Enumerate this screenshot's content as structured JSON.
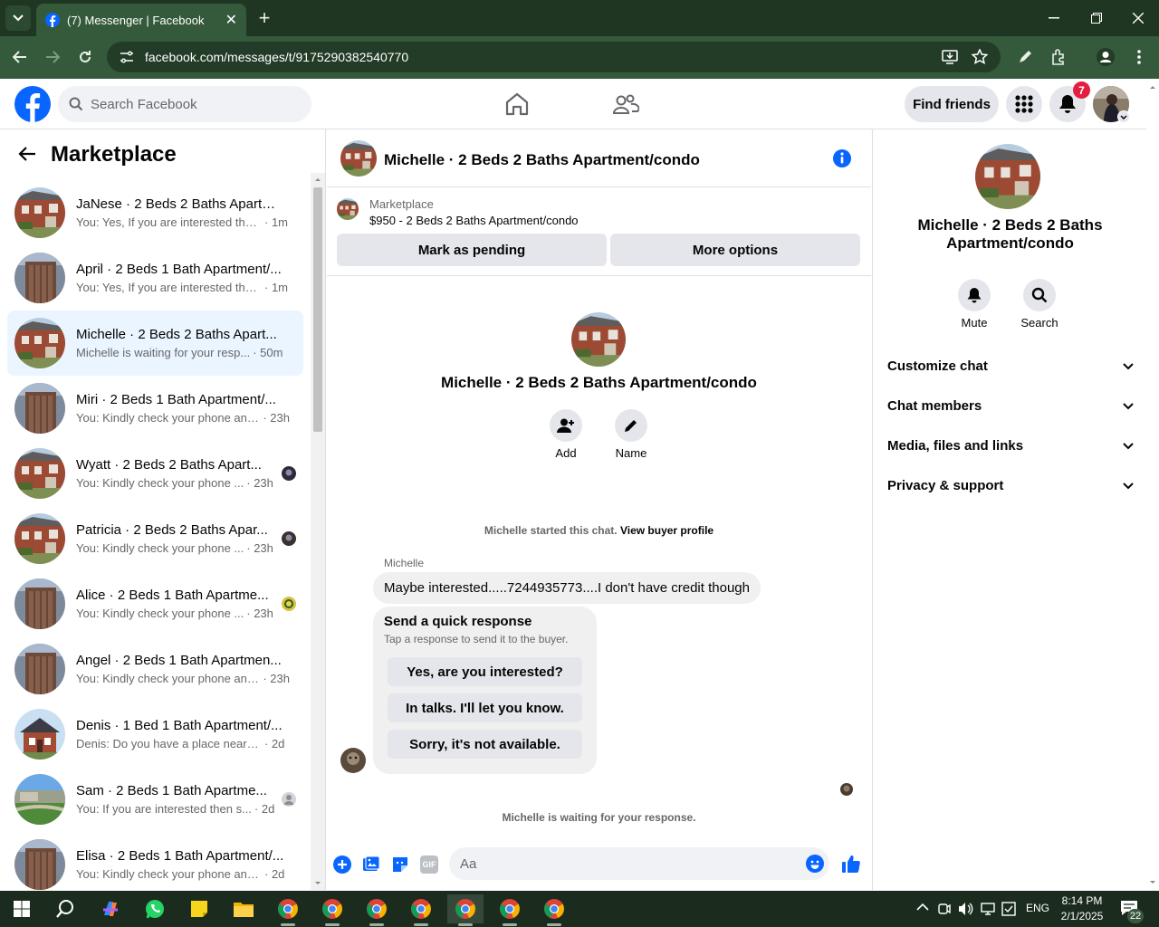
{
  "browser": {
    "tab_title": "(7) Messenger | Facebook",
    "url": "facebook.com/messages/t/9175290382540770"
  },
  "header": {
    "search_placeholder": "Search Facebook",
    "find_friends": "Find friends",
    "notification_count": "7"
  },
  "left": {
    "title": "Marketplace",
    "conversations": [
      {
        "title": "JaNese · 2 Beds 2 Baths Apartm...",
        "preview": "You: Yes, If you are interested then...",
        "time": "· 1m",
        "thumb": "brick"
      },
      {
        "title": "April · 2 Beds 1 Bath Apartment/...",
        "preview": "You: Yes, If you are interested then...",
        "time": "· 1m",
        "thumb": "door"
      },
      {
        "title": "Michelle · 2 Beds 2 Baths Apart...",
        "preview": "Michelle is waiting for your resp...",
        "time": "· 50m",
        "thumb": "brick"
      },
      {
        "title": "Miri · 2 Beds 1 Bath Apartment/...",
        "preview": "You: Kindly check your phone and...",
        "time": "· 23h",
        "thumb": "door"
      },
      {
        "title": "Wyatt · 2 Beds 2 Baths Apart...",
        "preview": "You: Kindly check your phone ...",
        "time": "· 23h",
        "thumb": "brick"
      },
      {
        "title": "Patricia · 2 Beds 2 Baths Apar...",
        "preview": "You: Kindly check your phone ...",
        "time": "· 23h",
        "thumb": "brick"
      },
      {
        "title": "Alice · 2 Beds 1 Bath Apartme...",
        "preview": "You: Kindly check your phone ...",
        "time": "· 23h",
        "thumb": "door"
      },
      {
        "title": "Angel · 2 Beds 1 Bath Apartmen...",
        "preview": "You: Kindly check your phone and...",
        "time": "· 23h",
        "thumb": "door"
      },
      {
        "title": "Denis · 1 Bed 1 Bath Apartment/...",
        "preview": "Denis: Do you have a place near 21...",
        "time": "· 2d",
        "thumb": "house"
      },
      {
        "title": "Sam · 2 Beds 1 Bath Apartme...",
        "preview": "You: If you are interested then s...",
        "time": "· 2d",
        "thumb": "lawn"
      },
      {
        "title": "Elisa · 2 Beds 1 Bath Apartment/...",
        "preview": "You: Kindly check your phone and I...",
        "time": "· 2d",
        "thumb": "door"
      }
    ]
  },
  "chat": {
    "title": "Michelle · 2 Beds 2 Baths Apartment/condo",
    "listing_label": "Marketplace",
    "listing_price": "$950 - 2 Beds 2 Baths Apartment/condo",
    "mark_pending": "Mark as pending",
    "more_options": "More options",
    "profile_name": "Michelle · 2 Beds 2 Baths Apartment/condo",
    "add_label": "Add",
    "name_label": "Name",
    "started_text": "Michelle started this chat.",
    "view_buyer": "View buyer profile",
    "sender": "Michelle",
    "message": "Maybe interested.....7244935773....I don't have credit though",
    "quick_title": "Send a quick response",
    "quick_sub": "Tap a response to send it to the buyer.",
    "quick_options": [
      "Yes, are you interested?",
      "In talks. I'll let you know.",
      "Sorry, it's not available."
    ],
    "waiting": "Michelle is waiting for your response.",
    "composer_placeholder": "Aa",
    "gif": "GIF"
  },
  "right": {
    "name_line1": "Michelle · 2 Beds 2 Baths",
    "name_line2": "Apartment/condo",
    "mute": "Mute",
    "search": "Search",
    "sections": [
      "Customize chat",
      "Chat members",
      "Media, files and links",
      "Privacy & support"
    ]
  },
  "taskbar": {
    "lang": "ENG",
    "time": "8:14 PM",
    "date": "2/1/2025",
    "notif_count": "22"
  },
  "colors": {
    "fb_blue": "#0866ff",
    "chrome_green": "#345a3b",
    "selected_bg": "#ebf5ff",
    "notif_red": "#e41e3f"
  }
}
